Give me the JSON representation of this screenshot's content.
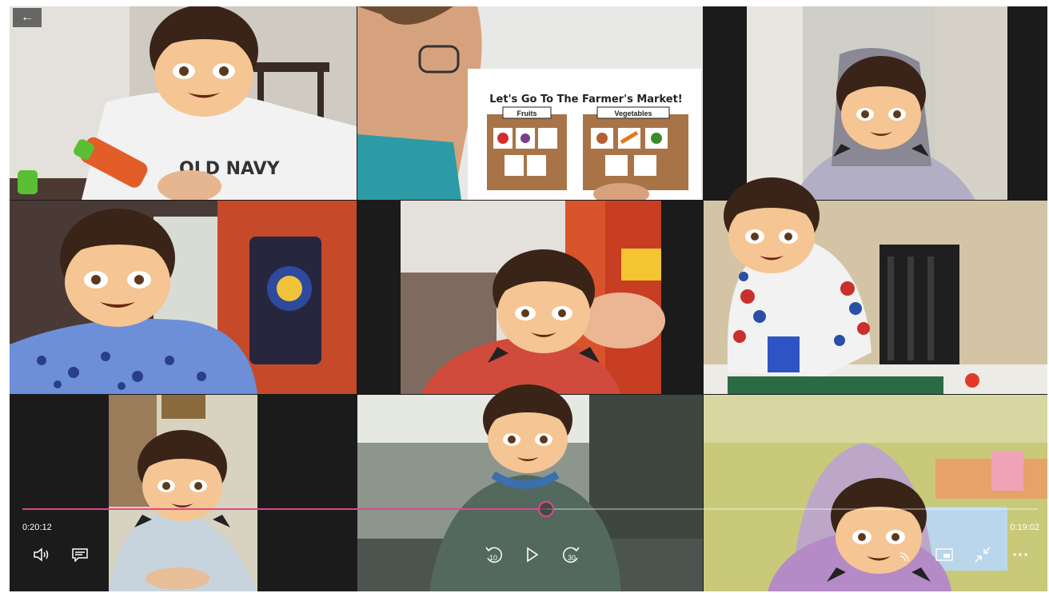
{
  "player": {
    "back_icon": "arrow-left-icon",
    "elapsed_time": "0:20:12",
    "remaining_time": "0:19:02",
    "progress_fraction": 0.516,
    "accent_color": "#e0468a",
    "controls_left": [
      "volume-icon",
      "captions-icon"
    ],
    "controls_center": [
      "skip-back-10-icon",
      "play-icon",
      "skip-forward-30-icon"
    ],
    "controls_right": [
      "cast-icon",
      "mini-view-icon",
      "exit-fullscreen-icon",
      "more-icon"
    ],
    "skip_back_label": "10",
    "skip_forward_label": "30"
  },
  "poster": {
    "title": "Let's Go To The Farmer's Market!",
    "basket_fruits": "Fruits",
    "basket_vegetables": "Vegetables"
  },
  "shirt": {
    "text": "OLD NAVY"
  },
  "tiles": [
    {
      "id": "participant-1"
    },
    {
      "id": "presenter"
    },
    {
      "id": "participant-2"
    },
    {
      "id": "participant-3"
    },
    {
      "id": "participant-4"
    },
    {
      "id": "participant-5"
    },
    {
      "id": "participant-6"
    },
    {
      "id": "participant-7"
    },
    {
      "id": "participant-8"
    }
  ]
}
